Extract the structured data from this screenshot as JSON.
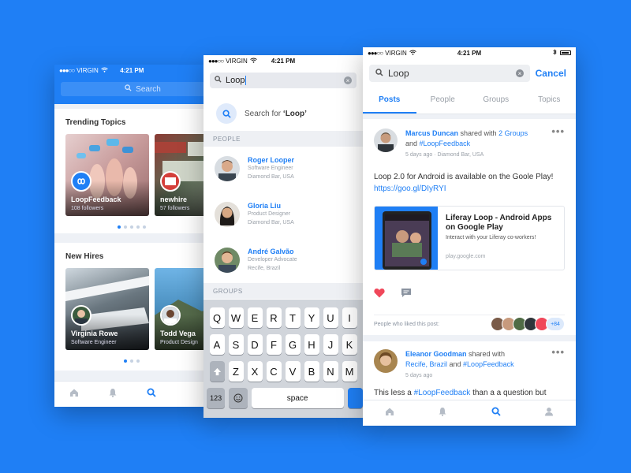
{
  "phone1": {
    "status": {
      "carrier": "VIRGIN",
      "time": "4:21 PM"
    },
    "search_placeholder": "Search",
    "trending": {
      "title": "Trending Topics",
      "tiles": [
        {
          "name": "LoopFeedback",
          "sub": "108 followers"
        },
        {
          "name": "newhire",
          "sub": "57 followers"
        }
      ]
    },
    "new_hires": {
      "title": "New Hires",
      "tiles": [
        {
          "name": "Virginia Rowe",
          "sub": "Software Engineer"
        },
        {
          "name": "Todd Vega",
          "sub": "Product Design"
        }
      ]
    }
  },
  "phone2": {
    "status": {
      "carrier": "VIRGIN",
      "time": "4:21 PM"
    },
    "search_value": "Loop",
    "suggestion_prefix": "Search for ",
    "suggestion_term": "‘Loop’",
    "people_header": "PEOPLE",
    "groups_header": "GROUPS",
    "people": [
      {
        "name": "Roger Looper",
        "role": "Software Engineer",
        "location": "Diamond Bar, USA"
      },
      {
        "name": "Gloria Liu",
        "role": "Product Designer",
        "location": "Diamond Bar, USA"
      },
      {
        "name": "André Galvão",
        "role": "Developer Advocate",
        "location": "Recife, Brazil"
      }
    ],
    "keyboard": {
      "row1": [
        "Q",
        "W",
        "E",
        "R",
        "T",
        "Y",
        "U",
        "I"
      ],
      "row2": [
        "A",
        "S",
        "D",
        "F",
        "G",
        "H",
        "J",
        "K"
      ],
      "row3": [
        "Z",
        "X",
        "C",
        "V",
        "B",
        "N",
        "M"
      ],
      "num": "123",
      "space": "space"
    }
  },
  "phone3": {
    "status": {
      "carrier": "VIRGIN",
      "time": "4:21 PM"
    },
    "search_value": "Loop",
    "cancel": "Cancel",
    "tabs": [
      "Posts",
      "People",
      "Groups",
      "Topics"
    ],
    "post1": {
      "author": "Marcus Duncan",
      "shared_text": " shared with ",
      "groups_link": "2 Groups",
      "and_text": "and ",
      "tag": "#LoopFeedback",
      "time": "5 days ago",
      "location": "Diamond Bar, USA",
      "body": "Loop 2.0 for Android is available on the Goole Play!",
      "url": "https://goo.gl/DIyRYI",
      "card": {
        "title": "Liferay Loop - Android Apps on Google Play",
        "desc": "Interact with your Liferay co-workers!",
        "domain": "play.google.com"
      },
      "likes_label": "People who liked this post:",
      "likes_more": "+84"
    },
    "post2": {
      "author": "Eleanor Goodman",
      "shared_text": " shared with",
      "place_link": "Recife, Brazil",
      "and_text": " and ",
      "tag": "#LoopFeedback",
      "time": "5 days ago",
      "body_prefix": "This less a ",
      "body_tag": "#LoopFeedback",
      "body_suffix": " than a a question but"
    }
  },
  "colors": {
    "brand": "#1f7ff5",
    "like": "#f0475a"
  }
}
